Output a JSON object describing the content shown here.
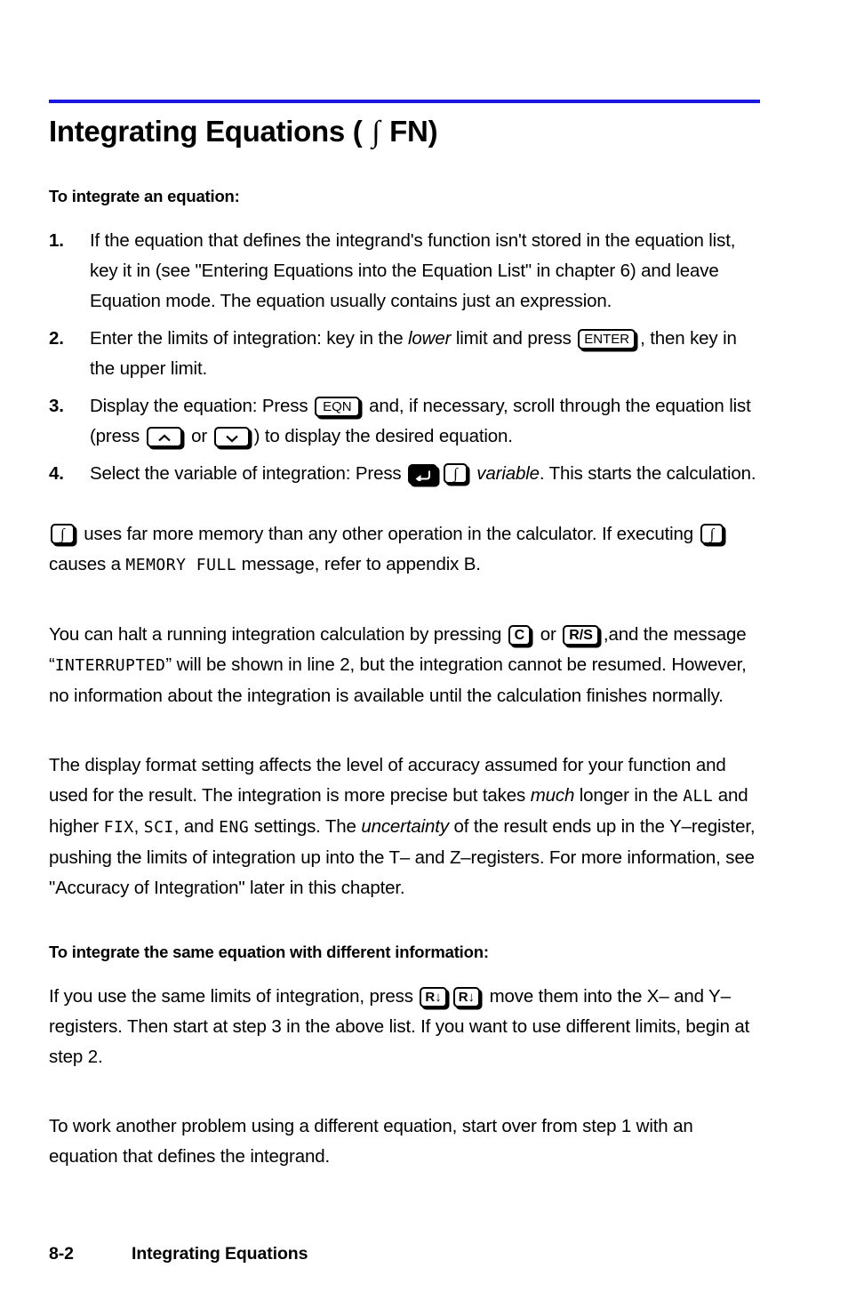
{
  "page": {
    "title_prefix": "Integrating Equations ( ",
    "title_integral": "∫",
    "title_suffix": " FN)",
    "rule_color": "#1818e0"
  },
  "sections": {
    "heading_1": "To integrate an equation:",
    "heading_2": "To integrate the same equation with different information:"
  },
  "steps": [
    {
      "number": "1.",
      "text": "If the equation that defines the integrand's function isn't stored in the equation list, key it in (see \"Entering Equations into the Equation List\" in chapter 6) and leave Equation mode. The equation usually contains just an expression."
    },
    {
      "number": "2.",
      "part_a": "Enter the limits of integration:  key in the ",
      "italic_a": "lower",
      "part_b": " limit and press ",
      "key": "ENTER",
      "part_c": ", then key in the upper limit."
    },
    {
      "number": "3.",
      "part_a": "Display the equation: Press ",
      "key_eqn": "EQN",
      "part_b": " and, if necessary, scroll through the equation list (press ",
      "key_up": "up-arrow",
      "part_c": " or ",
      "key_down": "down-arrow",
      "part_d": ") to display the desired equation."
    },
    {
      "number": "4.",
      "part_a": "Select the variable of integration: Press ",
      "key_shift": "shift",
      "key_integral": "∫",
      "part_b": " ",
      "italic_a": "variable",
      "part_c": ". This starts the calculation."
    }
  ],
  "paragraphs": {
    "memory": {
      "key_1": "∫",
      "part_a": " uses far more memory than any other operation in the calculator. If executing ",
      "key_2": "∫",
      "part_b": " causes a ",
      "lcd": "MEMORY FULL",
      "part_c": " message, refer to appendix B."
    },
    "halt": {
      "part_a": "You can halt a running integration calculation by pressing ",
      "key_c": "C",
      "part_b": " or ",
      "key_rs": "R/S",
      "part_c": ",and the message “",
      "lcd": "INTERRUPTED",
      "part_d": "” will be shown in line 2, but the integration cannot be resumed. However, no information about the integration is available until the calculation finishes normally."
    },
    "display_format": {
      "part_a": "The display format setting affects the level of accuracy assumed for your function and used for the result. The integration is more precise but takes ",
      "italic_a": "much",
      "part_b": " longer in the ",
      "lcd_all": "ALL",
      "part_c": " and higher ",
      "lcd_fix": "FIX",
      "part_d": ", ",
      "lcd_sci": "SCI",
      "part_e": ", and ",
      "lcd_eng": "ENG",
      "part_f": " settings. The ",
      "italic_b": "uncertainty",
      "part_g": " of the result ends up in the Y–register, pushing the limits of integration up into the T– and Z–registers. For more information, see \"Accuracy of Integration\" later in this chapter."
    },
    "same_limits": {
      "part_a": "If you use the same limits of integration, press ",
      "key_1": "R↓",
      "key_2": "R↓",
      "part_b": " move them into the X– and Y–registers. Then start at step 3 in the above list. If you want to use different limits, begin at step 2."
    },
    "another_problem": "To work another problem using a different equation, start over from step 1 with an equation that defines the integrand."
  },
  "footer": {
    "page_number": "8-2",
    "chapter_title": "Integrating Equations"
  }
}
